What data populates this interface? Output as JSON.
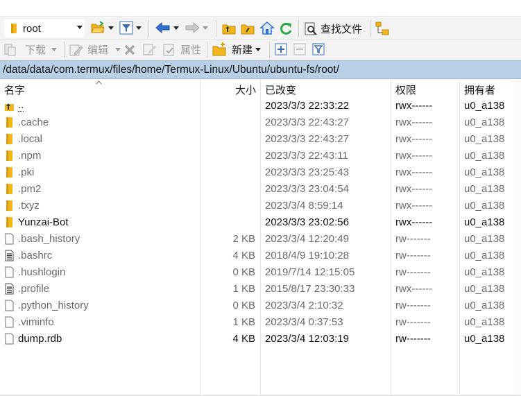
{
  "toolbar1": {
    "location": "root",
    "find_files_label": "查找文件"
  },
  "toolbar2": {
    "download_label": "下载",
    "edit_label": "编辑",
    "properties_label": "属性",
    "new_label": "新建"
  },
  "path": "/data/data/com.termux/files/home/Termux-Linux/Ubuntu/ubuntu-fs/root/",
  "columns": {
    "name": "名字",
    "size": "大小",
    "modified": "已改变",
    "permissions": "权限",
    "owner": "拥有者"
  },
  "files": [
    {
      "name": "..",
      "size": "",
      "modified": "2023/3/3 22:33:22",
      "permissions": "rwx------",
      "owner": "u0_a138",
      "icon": "parent-folder-icon"
    },
    {
      "name": ".cache",
      "size": "",
      "modified": "2023/3/3 22:43:27",
      "permissions": "rwx------",
      "owner": "u0_a138",
      "icon": "folder-icon"
    },
    {
      "name": ".local",
      "size": "",
      "modified": "2023/3/3 22:43:27",
      "permissions": "rwx------",
      "owner": "u0_a138",
      "icon": "folder-icon"
    },
    {
      "name": ".npm",
      "size": "",
      "modified": "2023/3/3 22:43:11",
      "permissions": "rwx------",
      "owner": "u0_a138",
      "icon": "folder-icon"
    },
    {
      "name": ".pki",
      "size": "",
      "modified": "2023/3/3 23:25:43",
      "permissions": "rwx------",
      "owner": "u0_a138",
      "icon": "folder-icon"
    },
    {
      "name": ".pm2",
      "size": "",
      "modified": "2023/3/3 23:04:54",
      "permissions": "rwx------",
      "owner": "u0_a138",
      "icon": "folder-icon"
    },
    {
      "name": ".txyz",
      "size": "",
      "modified": "2023/3/4 8:59:14",
      "permissions": "rwx------",
      "owner": "u0_a138",
      "icon": "folder-icon"
    },
    {
      "name": "Yunzai-Bot",
      "size": "",
      "modified": "2023/3/3 23:02:56",
      "permissions": "rwx------",
      "owner": "u0_a138",
      "icon": "folder-icon"
    },
    {
      "name": ".bash_history",
      "size": "2 KB",
      "modified": "2023/3/4 12:20:49",
      "permissions": "rw-------",
      "owner": "u0_a138",
      "icon": "file-icon"
    },
    {
      "name": ".bashrc",
      "size": "4 KB",
      "modified": "2018/4/9 19:10:28",
      "permissions": "rw-------",
      "owner": "u0_a138",
      "icon": "text-file-icon"
    },
    {
      "name": ".hushlogin",
      "size": "0 KB",
      "modified": "2019/7/14 12:15:05",
      "permissions": "rw-------",
      "owner": "u0_a138",
      "icon": "file-icon"
    },
    {
      "name": ".profile",
      "size": "1 KB",
      "modified": "2015/8/17 23:30:33",
      "permissions": "rwx------",
      "owner": "u0_a138",
      "icon": "text-file-icon"
    },
    {
      "name": ".python_history",
      "size": "0 KB",
      "modified": "2023/3/4 2:10:32",
      "permissions": "rw-------",
      "owner": "u0_a138",
      "icon": "file-icon"
    },
    {
      "name": ".viminfo",
      "size": "1 KB",
      "modified": "2023/3/4 0:37:53",
      "permissions": "rw-------",
      "owner": "u0_a138",
      "icon": "file-icon"
    },
    {
      "name": "dump.rdb",
      "size": "4 KB",
      "modified": "2023/3/4 12:03:19",
      "permissions": "rw-------",
      "owner": "u0_a138",
      "icon": "file-icon"
    }
  ],
  "colors": {
    "path_bar": "#b9cfe6",
    "toolbar_bg": "#f3f3f3",
    "folder": "#f2b51c",
    "arrow_blue": "#2f6fd1",
    "refresh_green": "#2ea84a"
  }
}
